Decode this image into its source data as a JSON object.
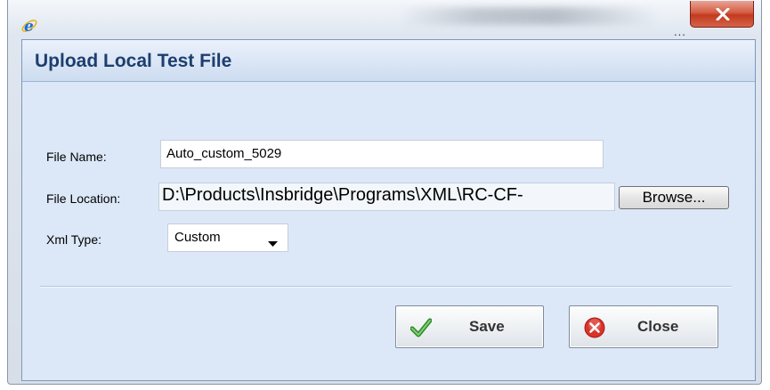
{
  "window": {
    "ellipsis": "...",
    "close_glyph": "X"
  },
  "dialog": {
    "title": "Upload Local Test File"
  },
  "form": {
    "file_name": {
      "label": "File Name:",
      "value": "Auto_custom_5029"
    },
    "file_location": {
      "label": "File Location:",
      "value": "D:\\Products\\Insbridge\\Programs\\XML\\RC-CF-",
      "browse_label": "Browse..."
    },
    "xml_type": {
      "label": "Xml Type:",
      "selected": "Custom"
    }
  },
  "buttons": {
    "save_label": "Save",
    "close_label": "Close"
  },
  "icons": {
    "app": "internet-explorer-icon",
    "save": "checkmark-icon",
    "close": "red-x-circle-icon"
  },
  "colors": {
    "title_text": "#1d3f6e",
    "dialog_bg": "#dce8f8",
    "close_button": "#c23a1e",
    "save_check": "#3fa33a",
    "close_circle": "#d9332a"
  }
}
